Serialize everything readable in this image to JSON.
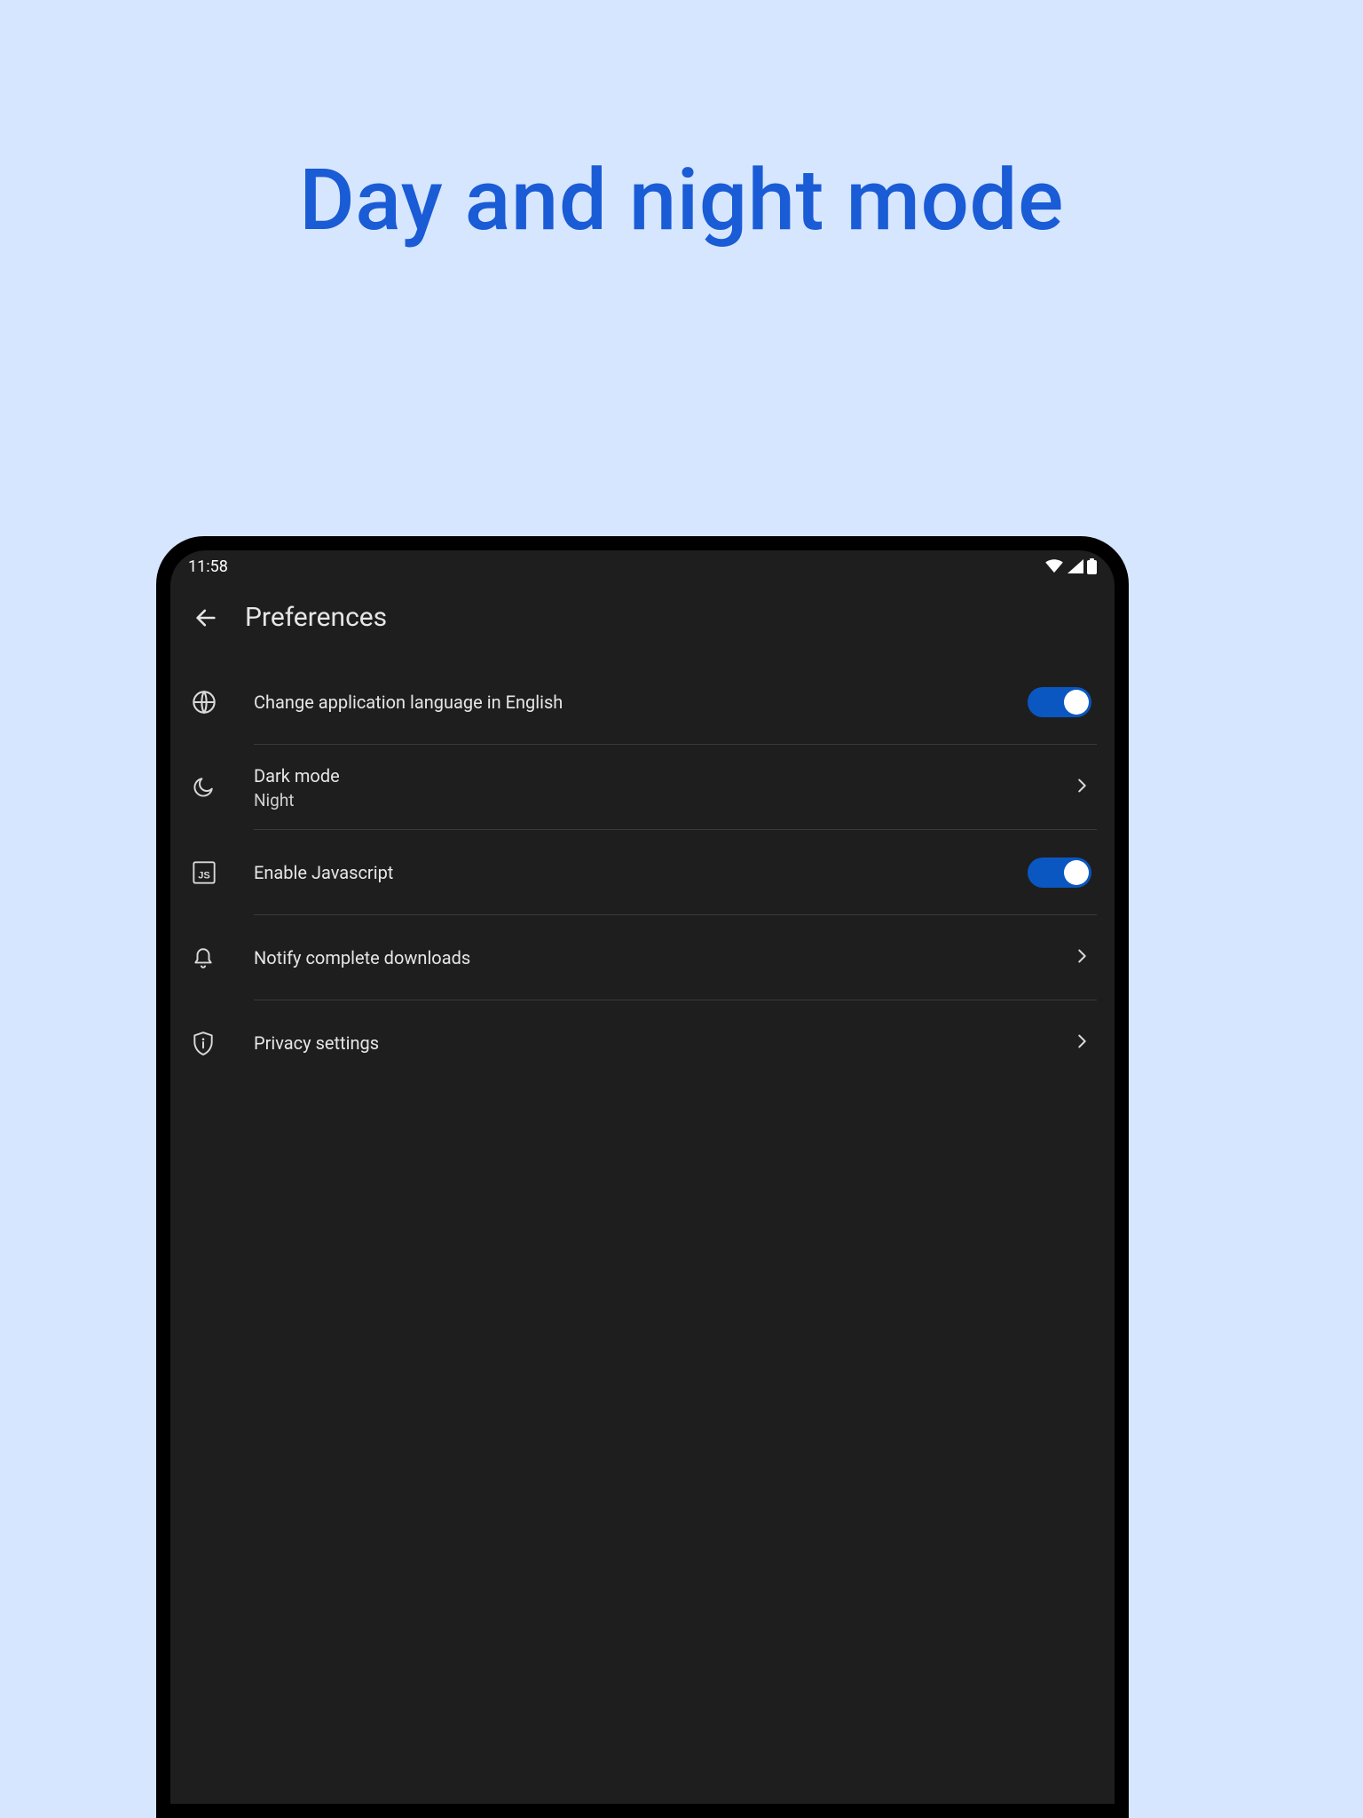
{
  "headline": "Day and night mode",
  "statusbar": {
    "time": "11:58"
  },
  "appbar": {
    "title": "Preferences"
  },
  "rows": {
    "language": {
      "label": "Change application language in English"
    },
    "darkmode": {
      "label": "Dark mode",
      "sublabel": "Night"
    },
    "javascript": {
      "label": "Enable Javascript"
    },
    "downloads": {
      "label": "Notify complete downloads"
    },
    "privacy": {
      "label": "Privacy settings"
    }
  },
  "toggles": {
    "language_on": true,
    "javascript_on": true
  }
}
